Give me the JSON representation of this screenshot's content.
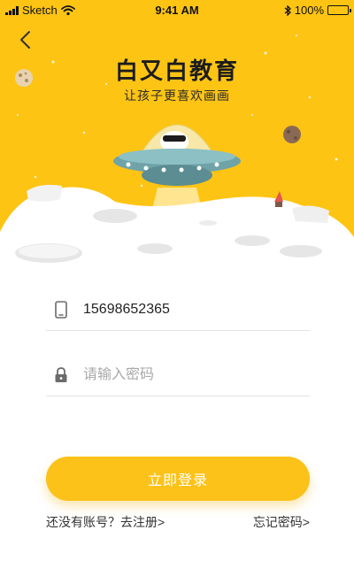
{
  "status_bar": {
    "carrier": "Sketch",
    "time": "9:41 AM",
    "battery": "100%",
    "battery_level": 1.0
  },
  "brand": {
    "title": "白又白教育",
    "subtitle": "让孩子更喜欢画画",
    "accent_color": "#fcc219"
  },
  "form": {
    "phone_value": "15698652365",
    "password_placeholder": "请输入密码"
  },
  "actions": {
    "login_label": "立即登录",
    "register_link": "还没有账号？去注册>",
    "forgot_link": "忘记密码>"
  },
  "icons": [
    "back-chevron-icon",
    "wifi-icon",
    "bluetooth-icon",
    "battery-icon",
    "phone-icon",
    "lock-icon"
  ]
}
